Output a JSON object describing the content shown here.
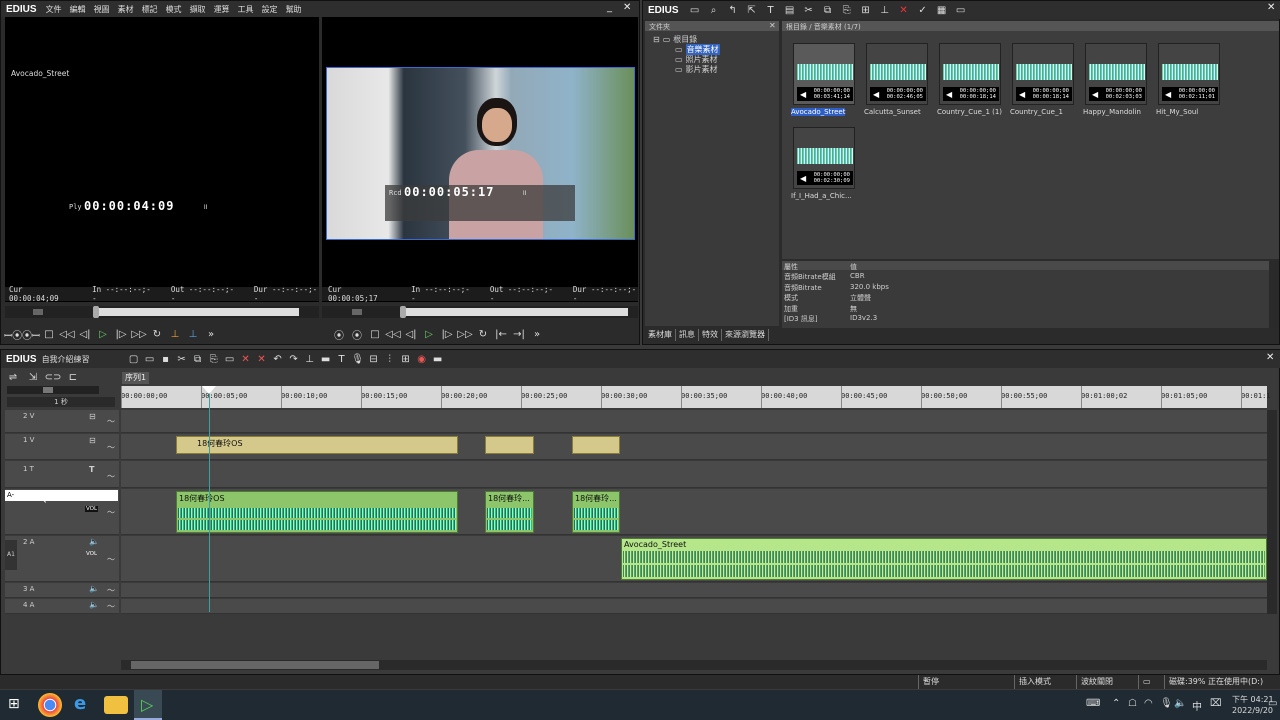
{
  "app": {
    "logo": "EDIUS"
  },
  "menu": [
    "文件",
    "編輯",
    "視圖",
    "素材",
    "標記",
    "模式",
    "擷取",
    "運算",
    "工具",
    "設定",
    "幫助"
  ],
  "player": {
    "label": "Avocado_Street",
    "timecode_prefix": "Ply",
    "timecode": "00:00:04:09",
    "cur": "Cur 00:00:04;09",
    "in": "In --:--:--;--",
    "out": "Out --:--:--;--",
    "dur": "Dur --:--:--;--"
  },
  "recorder": {
    "timecode_prefix": "Rcd",
    "timecode": "00:00:05:17",
    "cur": "Cur 00:00:05;17",
    "in": "In --:--:--;--",
    "out": "Out --:--:--;--",
    "dur": "Dur --:--:--;--"
  },
  "bin": {
    "logo": "EDIUS",
    "folder_title": "文件夾",
    "tree": [
      "根目錄",
      "音樂素材",
      "照片素材",
      "影片素材"
    ],
    "path": "根目錄 / 音樂素材 (1/7)",
    "clips": [
      {
        "name": "Avocado_Street",
        "dur1": "00:00:00;00",
        "dur2": "00:03:41;14"
      },
      {
        "name": "Calcutta_Sunset",
        "dur1": "00:00:00;00",
        "dur2": "00:02:46;05"
      },
      {
        "name": "Country_Cue_1 (1)",
        "dur1": "00:00:00;00",
        "dur2": "00:00:18;14"
      },
      {
        "name": "Country_Cue_1",
        "dur1": "00:00:00;00",
        "dur2": "00:00:18;14"
      },
      {
        "name": "Happy_Mandolin",
        "dur1": "00:00:00;00",
        "dur2": "00:02:03;03"
      },
      {
        "name": "Hit_My_Soul",
        "dur1": "00:00:00;00",
        "dur2": "00:02:11;01"
      },
      {
        "name": "If_I_Had_a_Chic...",
        "dur1": "00:00:00;00",
        "dur2": "00:02:30;09"
      }
    ],
    "props_header": [
      "屬性",
      "值"
    ],
    "props": [
      [
        "音頻Bitrate模組",
        "CBR"
      ],
      [
        "音頻Bitrate",
        "320.0 kbps"
      ],
      [
        "模式",
        "立體聲"
      ],
      [
        "加重",
        "無"
      ],
      [
        "[ID3 訊息]",
        "ID3v2.3"
      ]
    ],
    "tabs": [
      "素材庫",
      "訊息",
      "特效",
      "來源瀏覽器"
    ]
  },
  "timeline": {
    "logo": "EDIUS",
    "project": "自我介紹練習",
    "sequence_tab": "序列1",
    "scale": "1 秒",
    "ruler": [
      "00:00:00;00",
      "00:00:05;00",
      "00:00:10;00",
      "00:00:15;00",
      "00:00:20;00",
      "00:00:25;00",
      "00:00:30;00",
      "00:00:35;00",
      "00:00:40;00",
      "00:00:45;00",
      "00:00:50;00",
      "00:00:55;00",
      "00:01:00;02",
      "00:01:05;00",
      "00:01:1"
    ],
    "tracks": {
      "t2v": "2 V",
      "t1v": "1 V",
      "t1t": "1 T",
      "ta": "A-",
      "t2a": "2 A",
      "t3a": "3 A",
      "t4a": "4 A",
      "vol": "VOL"
    },
    "clips": {
      "v1": "18何春玲OS",
      "a1a": "18何春玲OS",
      "a1b": "18何春玲...",
      "a1c": "18何春玲...",
      "a2": "Avocado_Street"
    }
  },
  "status": {
    "state": "暫停",
    "mode": "插入模式",
    "ripple": "波紋關閉",
    "disk": "磁碟:39% 正在使用中(D:)"
  },
  "taskbar": {
    "ime": "中",
    "time": "下午 04:21",
    "date": "2022/9/20"
  }
}
